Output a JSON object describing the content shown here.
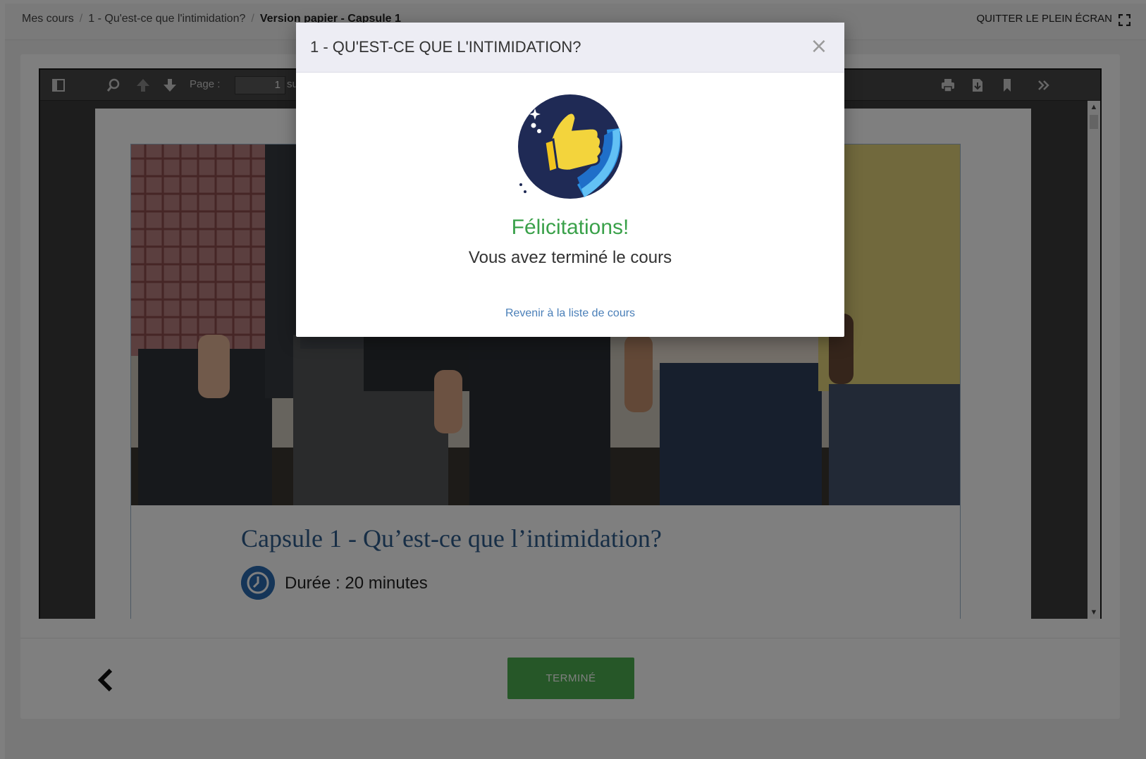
{
  "breadcrumb": {
    "items": [
      "Mes cours",
      "1 - Qu'est-ce que l'intimidation?"
    ],
    "current": "Version papier - Capsule 1"
  },
  "header": {
    "exit_fullscreen_label": "QUITTER LE PLEIN ÉCRAN",
    "exit_fullscreen_icon": "fullscreen-exit-icon"
  },
  "pdf_viewer": {
    "toolbar": {
      "sidebar_icon": "sidebar-toggle-icon",
      "search_icon": "search-icon",
      "prev_icon": "arrow-up-icon",
      "next_icon": "arrow-down-icon",
      "page_label": "Page :",
      "page_value": "1",
      "page_of": "su",
      "print_icon": "print-icon",
      "download_icon": "download-icon",
      "bookmark_icon": "bookmark-icon",
      "more_icon": "double-chevron-right-icon"
    },
    "document": {
      "title": "Capsule 1 - Qu’est-ce que l’intimidation?",
      "duration": "Durée : 20 minutes",
      "clock_icon": "clock-icon"
    }
  },
  "footer": {
    "back_icon": "chevron-left-icon",
    "done_label": "TERMINÉ",
    "done_color": "#4caf50"
  },
  "modal": {
    "title": "1 - QU'EST-CE QUE L'INTIMIDATION?",
    "close_symbol": "×",
    "badge_icon": "thumbs-up-badge-icon",
    "congrats": "Félicitations!",
    "congrats_color": "#3aa14a",
    "message": "Vous avez terminé le cours",
    "back_link": "Revenir à la liste de cours"
  }
}
